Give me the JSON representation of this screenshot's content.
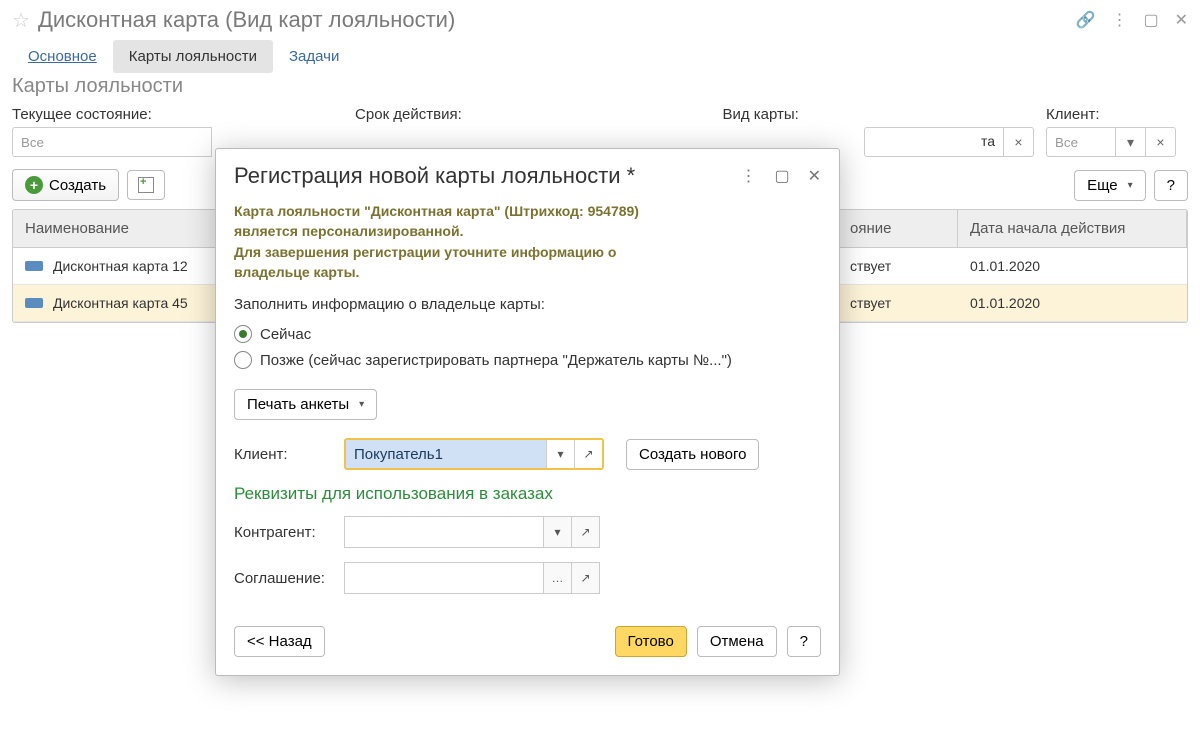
{
  "window": {
    "title": "Дисконтная карта (Вид карт лояльности)"
  },
  "tabs": [
    {
      "label": "Основное"
    },
    {
      "label": "Карты лояльности"
    },
    {
      "label": "Задачи"
    }
  ],
  "page_subtitle": "Карты лояльности",
  "filters": {
    "state": {
      "label": "Текущее состояние:",
      "value": "Все"
    },
    "validity": {
      "label": "Срок действия:"
    },
    "card_type": {
      "label": "Вид карты:",
      "value_suffix": "та"
    },
    "client": {
      "label": "Клиент:",
      "value": "Все"
    }
  },
  "toolbar": {
    "create": "Создать",
    "more": "Еще",
    "help": "?"
  },
  "table": {
    "headers": {
      "name": "Наименование",
      "state": "ояние",
      "date": "Дата начала действия"
    },
    "rows": [
      {
        "name": "Дисконтная карта 12",
        "state": "ствует",
        "date": "01.01.2020"
      },
      {
        "name": "Дисконтная карта 45",
        "state": "ствует",
        "date": "01.01.2020"
      }
    ]
  },
  "modal": {
    "title": "Регистрация новой карты лояльности *",
    "info_line1": "Карта лояльности \"Дисконтная карта\" (Штрихкод: 954789)",
    "info_line2": "является персонализированной.",
    "info_line3": "Для завершения регистрации уточните информацию о",
    "info_line4": "владельце карты.",
    "fill_prompt": "Заполнить информацию о владельце карты:",
    "radio_now": "Сейчас",
    "radio_later": "Позже (сейчас зарегистрировать партнера \"Держатель карты №...\")",
    "print_form": "Печать анкеты",
    "client_label": "Клиент:",
    "client_value": "Покупатель1",
    "create_new": "Создать нового",
    "section_orders": "Реквизиты для использования в заказах",
    "counterparty": "Контрагент:",
    "agreement": "Соглашение:",
    "back": "<< Назад",
    "done": "Готово",
    "cancel": "Отмена",
    "help": "?"
  }
}
